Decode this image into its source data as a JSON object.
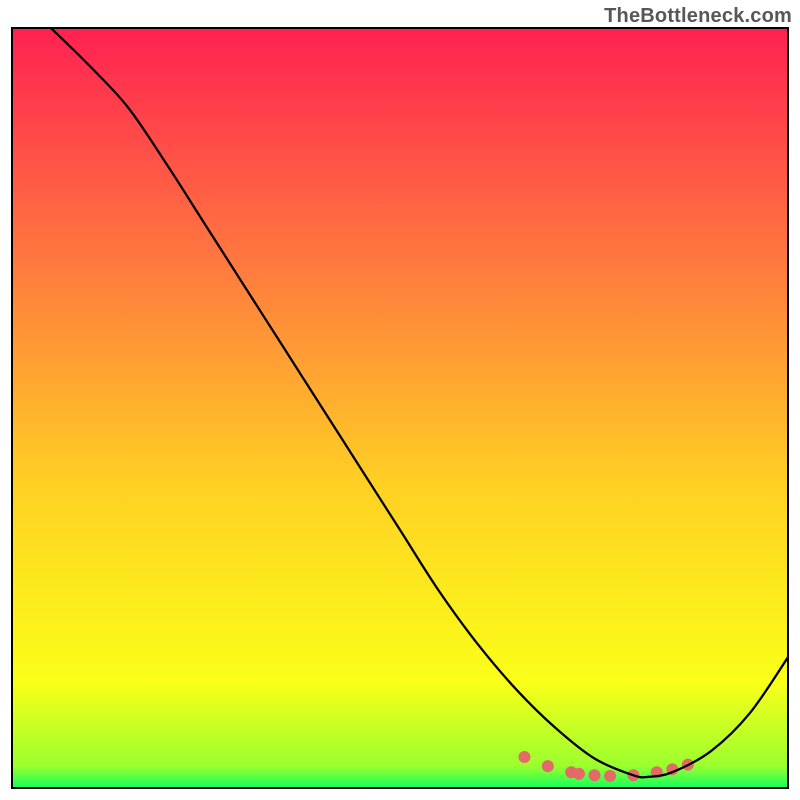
{
  "watermark": "TheBottleneck.com",
  "chart_data": {
    "type": "line",
    "title": "",
    "xlabel": "",
    "ylabel": "",
    "xlim": [
      0,
      100
    ],
    "ylim": [
      0,
      100
    ],
    "grid": false,
    "legend": false,
    "curve_x": [
      5,
      10,
      15,
      20,
      25,
      30,
      35,
      40,
      45,
      50,
      55,
      60,
      65,
      70,
      75,
      80,
      82,
      85,
      90,
      95,
      100
    ],
    "curve_y": [
      100,
      95,
      89.5,
      82,
      74,
      66,
      58,
      50,
      42,
      34,
      26,
      19,
      13,
      8,
      4,
      1.8,
      1.6,
      2.2,
      5,
      10,
      17.5
    ],
    "marker_points_x": [
      66,
      69,
      72,
      73,
      75,
      77,
      80,
      83,
      85,
      87
    ],
    "marker_points_y": [
      4.2,
      3.0,
      2.2,
      2.0,
      1.8,
      1.7,
      1.8,
      2.2,
      2.6,
      3.2
    ],
    "colors": {
      "gradient_top": "#ff2151",
      "gradient_upper_mid": "#ff7c3e",
      "gradient_mid": "#ffd024",
      "gradient_lower_mid": "#faff18",
      "gradient_bottom": "#0cff5f",
      "curve": "#000000",
      "markers": "#e46a6a",
      "frame": "#000000"
    }
  }
}
